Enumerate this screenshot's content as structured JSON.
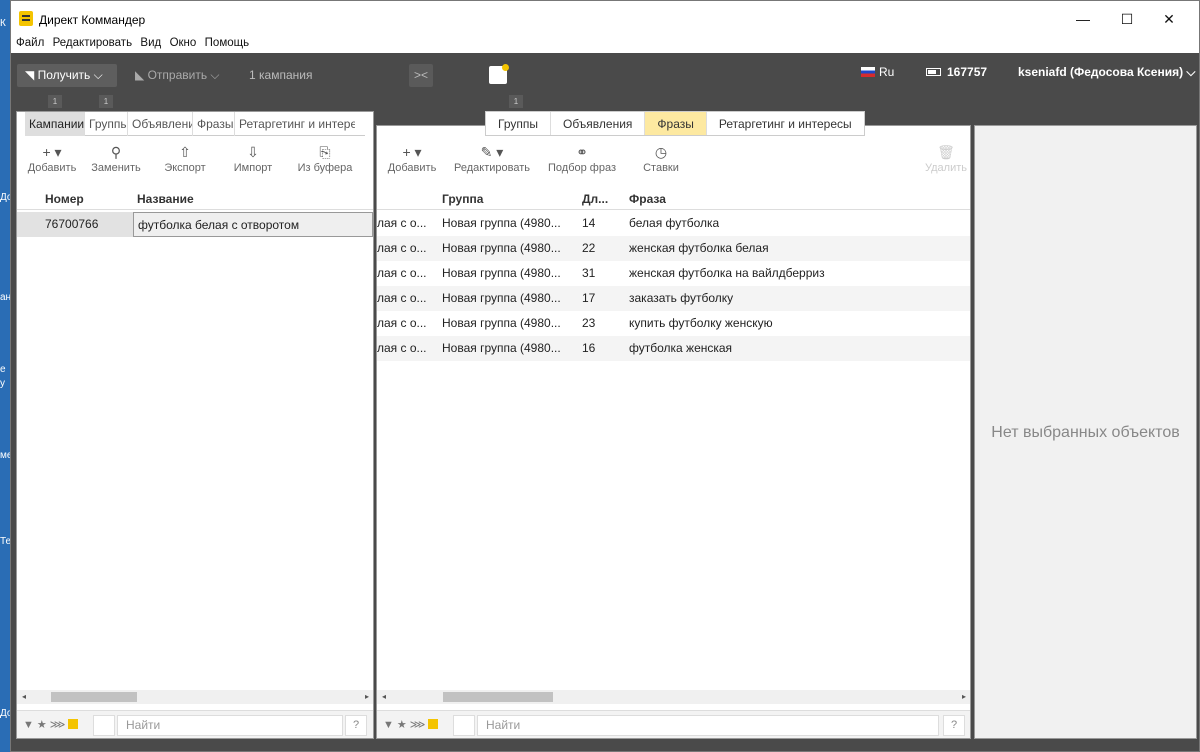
{
  "window": {
    "title": "Директ Коммандер",
    "controls": {
      "minimize": "—",
      "maximize": "☐",
      "close": "✕"
    }
  },
  "desktop_left": [
    "К",
    "До",
    "ан",
    "е",
    "у",
    "ме",
    "Те",
    "До"
  ],
  "menu": [
    "Файл",
    "Редактировать",
    "Вид",
    "Окно",
    "Помощь"
  ],
  "toolbar": {
    "get_label": "Получить",
    "send_label": "Отправить",
    "campaign_count": "1 кампания",
    "collapse_label": "><",
    "language": "Ru",
    "balance": "167757",
    "user": "kseniafd (Федосова Ксения)"
  },
  "badges": [
    "1",
    "1",
    "1"
  ],
  "left_panel": {
    "tabs": [
      "Кампании",
      "Группы",
      "Объявления",
      "Фразы",
      "Ретаргетинг и интересы"
    ],
    "actions": [
      "Добавить",
      "Заменить",
      "Экспорт",
      "Импорт",
      "Из буфера"
    ],
    "columns": [
      "Номер",
      "Название"
    ],
    "rows": [
      {
        "number": "76700766",
        "name": "футболка белая с отворотом"
      }
    ],
    "search_placeholder": "Найти",
    "help": "?"
  },
  "mid_panel": {
    "tabs": [
      "Группы",
      "Объявления",
      "Фразы",
      "Ретаргетинг и интересы"
    ],
    "active_tab": "Фразы",
    "actions": [
      "Добавить",
      "Редактировать",
      "Подбор фраз",
      "Ставки",
      "Удалить"
    ],
    "columns": [
      "Группа",
      "Дл...",
      "Фраза"
    ],
    "rows": [
      {
        "campaign": "лая с о...",
        "group": "Новая группа (4980...",
        "length": "14",
        "phrase": "белая футболка"
      },
      {
        "campaign": "лая с о...",
        "group": "Новая группа (4980...",
        "length": "22",
        "phrase": "женская футболка белая"
      },
      {
        "campaign": "лая с о...",
        "group": "Новая группа (4980...",
        "length": "31",
        "phrase": "женская футболка на вайлдберриз"
      },
      {
        "campaign": "лая с о...",
        "group": "Новая группа (4980...",
        "length": "17",
        "phrase": "заказать футболку"
      },
      {
        "campaign": "лая с о...",
        "group": "Новая группа (4980...",
        "length": "23",
        "phrase": "купить футболку женскую"
      },
      {
        "campaign": "лая с о...",
        "group": "Новая группа (4980...",
        "length": "16",
        "phrase": "футболка женская"
      }
    ],
    "search_placeholder": "Найти",
    "help": "?"
  },
  "right_panel": {
    "empty_text": "Нет выбранных объектов"
  },
  "colors": {
    "active_tab": "#fde9a1",
    "accent": "#f4c400",
    "toolbar_bg": "#4a4a4a"
  }
}
